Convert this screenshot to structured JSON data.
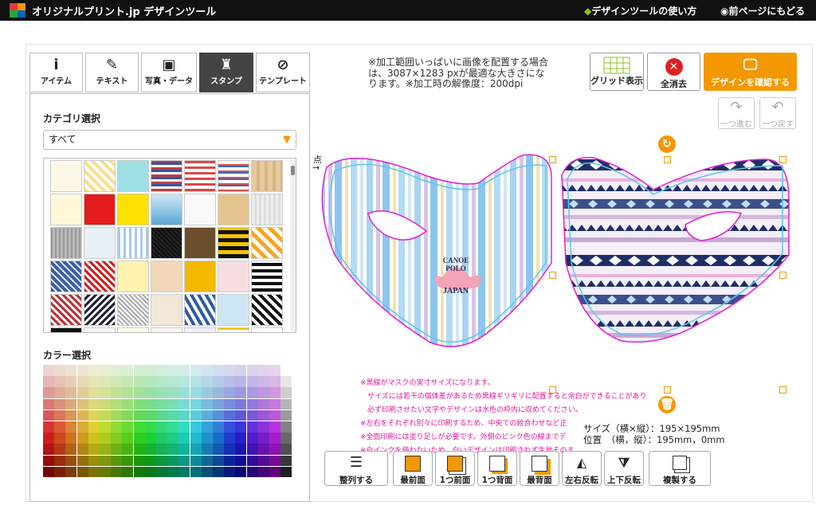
{
  "header": {
    "brand": "オリジナルプリント.jp デザインツール",
    "help_link": "デザインツールの使い方",
    "back_link": "前ページにもどる"
  },
  "tabs": [
    {
      "label": "アイテム",
      "icon": "info-icon"
    },
    {
      "label": "テキスト",
      "icon": "pen-icon"
    },
    {
      "label": "写真・データ",
      "icon": "image-icon"
    },
    {
      "label": "スタンプ",
      "icon": "stamp-icon",
      "active": true
    },
    {
      "label": "テンプレート",
      "icon": "template-icon"
    }
  ],
  "stamp_panel": {
    "category_title": "カテゴリ選択",
    "category_value": "すべて",
    "color_title": "カラー選択"
  },
  "info_text": "※加工範囲いっぱいに画像を配置する場合は、3087×1283 pxが最適な大きさになります。※加工時の解像度：200dpi",
  "toolbar": {
    "grid_label": "グリッド表示",
    "clear_label": "全消去",
    "confirm_label": "デザインを確認する",
    "redo_label": "一つ進む",
    "undo_label": "一つ戻す"
  },
  "canvas": {
    "side_label": "点",
    "logo_line1": "CANOE",
    "logo_line2": "POLO",
    "logo_line3": "JAPAN"
  },
  "notes": [
    "※黒線がマスクの実寸サイズになります。",
    "　サイズには若干の個体差があるため黒線ギリギリに配置すると余白ができることがあり",
    "　必ず印刷させたい文字やデザインは水色の枠内に収めてください。",
    "※左右をそれぞれ別々に印刷するため、中央での絵合わせなど正",
    "※全面印刷には塗り足しが必要です。外側のピンク色の線までデ",
    "※白インクを使わないため、白いデザインは印刷されず生地そのま"
  ],
  "size_info": {
    "size_line": "サイズ（横×縦）：195×195mm",
    "pos_line": "位置　（横，縦）：195mm，0mm"
  },
  "bottom_buttons": [
    {
      "label": "整列する"
    },
    {
      "label": "最前面"
    },
    {
      "label": "1つ前面"
    },
    {
      "label": "1つ背面"
    },
    {
      "label": "最背面"
    },
    {
      "label": "左右反転"
    },
    {
      "label": "上下反転"
    },
    {
      "label": "複製する"
    }
  ],
  "colors": {
    "accent": "#f39800",
    "mask_outline": "#e01fd4",
    "print_area": "#5ec4f0",
    "delete": "#e02020"
  }
}
